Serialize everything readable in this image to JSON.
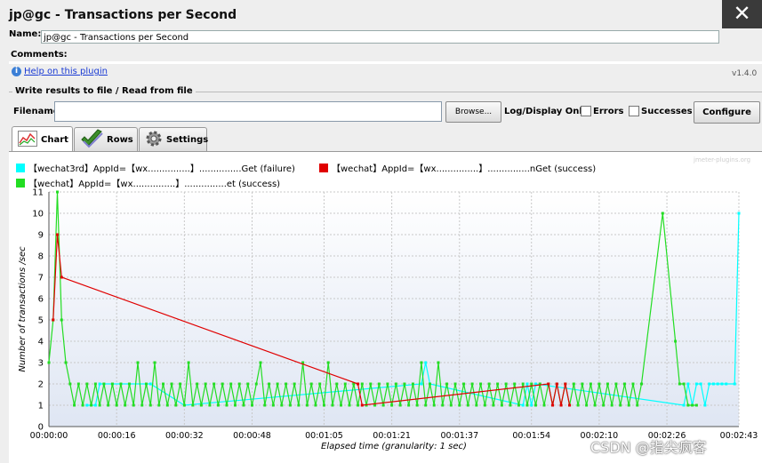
{
  "window": {
    "title": "jp@gc - Transactions per Second",
    "close_glyph": "✕"
  },
  "name_row": {
    "label": "Name:",
    "value": "jp@gc - Transactions per Second"
  },
  "comments": {
    "label": "Comments:"
  },
  "help": {
    "link_text": "Help on this plugin",
    "version": "v1.4.0"
  },
  "file_section": {
    "legend": "Write results to file / Read from file",
    "filename_label": "Filename",
    "filename_value": "",
    "browse_label": "Browse...",
    "log_display_label": "Log/Display Only:",
    "errors_label": "Errors",
    "successes_label": "Successes",
    "configure_label": "Configure"
  },
  "tabs": [
    {
      "label": "Chart",
      "icon": "chart-icon",
      "active": true
    },
    {
      "label": "Rows",
      "icon": "checkmark-icon",
      "active": false
    },
    {
      "label": "Settings",
      "icon": "gear-icon",
      "active": false
    }
  ],
  "watermark": "jmeter-plugins.org",
  "footer_watermark": "CSDN @指尖疯客",
  "colors": {
    "cyan": "#00ffff",
    "red": "#e00000",
    "green": "#22dd22",
    "grid": "#c8c8c8"
  },
  "chart_data": {
    "type": "line",
    "ylabel": "Number of transactions /sec",
    "xlabel": "Elapsed time (granularity: 1 sec)",
    "ylim": [
      0,
      11
    ],
    "yticks": [
      0,
      1,
      2,
      3,
      4,
      5,
      6,
      7,
      8,
      9,
      10,
      11
    ],
    "xlim": [
      0,
      163
    ],
    "xticks": [
      {
        "t": 0,
        "label": "00:00:00"
      },
      {
        "t": 16,
        "label": "00:00:16"
      },
      {
        "t": 32,
        "label": "00:00:32"
      },
      {
        "t": 48,
        "label": "00:00:48"
      },
      {
        "t": 65,
        "label": "00:01:05"
      },
      {
        "t": 81,
        "label": "00:01:21"
      },
      {
        "t": 97,
        "label": "00:01:37"
      },
      {
        "t": 114,
        "label": "00:01:54"
      },
      {
        "t": 130,
        "label": "00:02:10"
      },
      {
        "t": 146,
        "label": "00:02:26"
      },
      {
        "t": 163,
        "label": "00:02:43"
      }
    ],
    "series": [
      {
        "name": "【wechat3rd】AppId=【wx...............】...............Get (failure)",
        "color": "#00ffff",
        "points": [
          [
            9,
            1
          ],
          [
            10,
            1
          ],
          [
            11,
            1
          ],
          [
            12,
            2
          ],
          [
            24,
            2
          ],
          [
            32,
            1
          ],
          [
            88,
            2
          ],
          [
            89,
            3
          ],
          [
            90,
            2
          ],
          [
            112,
            1
          ],
          [
            113,
            2
          ],
          [
            114,
            1
          ],
          [
            115,
            2
          ],
          [
            150,
            1
          ],
          [
            151,
            2
          ],
          [
            152,
            1
          ],
          [
            153,
            2
          ],
          [
            154,
            2
          ],
          [
            155,
            1
          ],
          [
            156,
            2
          ],
          [
            157,
            2
          ],
          [
            158,
            2
          ],
          [
            159,
            2
          ],
          [
            160,
            2
          ],
          [
            162,
            2
          ],
          [
            163,
            10
          ]
        ]
      },
      {
        "name": "【wechat】AppId=【wx...............】...............nGet (success)",
        "color": "#e00000",
        "points": [
          [
            1,
            5
          ],
          [
            2,
            9
          ],
          [
            3,
            7
          ],
          [
            73,
            2
          ],
          [
            74,
            1
          ],
          [
            118,
            2
          ],
          [
            119,
            1
          ],
          [
            120,
            2
          ],
          [
            121,
            1
          ],
          [
            122,
            2
          ],
          [
            123,
            1
          ]
        ]
      },
      {
        "name": "【wechat】AppId=【wx...............】...............et (success)",
        "color": "#22dd22",
        "points": [
          [
            0,
            3
          ],
          [
            1,
            5
          ],
          [
            2,
            11
          ],
          [
            3,
            5
          ],
          [
            4,
            3
          ],
          [
            5,
            2
          ],
          [
            6,
            1
          ],
          [
            7,
            2
          ],
          [
            8,
            1
          ],
          [
            9,
            2
          ],
          [
            10,
            1
          ],
          [
            11,
            2
          ],
          [
            12,
            1
          ],
          [
            13,
            2
          ],
          [
            14,
            1
          ],
          [
            15,
            2
          ],
          [
            16,
            1
          ],
          [
            17,
            2
          ],
          [
            18,
            1
          ],
          [
            19,
            2
          ],
          [
            20,
            1
          ],
          [
            21,
            3
          ],
          [
            22,
            1
          ],
          [
            23,
            2
          ],
          [
            24,
            1
          ],
          [
            25,
            3
          ],
          [
            26,
            1
          ],
          [
            27,
            2
          ],
          [
            28,
            1
          ],
          [
            29,
            2
          ],
          [
            30,
            1
          ],
          [
            31,
            2
          ],
          [
            32,
            1
          ],
          [
            33,
            3
          ],
          [
            34,
            1
          ],
          [
            35,
            2
          ],
          [
            36,
            1
          ],
          [
            37,
            2
          ],
          [
            38,
            1
          ],
          [
            39,
            2
          ],
          [
            40,
            1
          ],
          [
            41,
            2
          ],
          [
            42,
            1
          ],
          [
            43,
            2
          ],
          [
            44,
            1
          ],
          [
            45,
            2
          ],
          [
            46,
            1
          ],
          [
            47,
            2
          ],
          [
            48,
            1
          ],
          [
            49,
            2
          ],
          [
            50,
            3
          ],
          [
            51,
            1
          ],
          [
            52,
            2
          ],
          [
            53,
            1
          ],
          [
            54,
            2
          ],
          [
            55,
            1
          ],
          [
            56,
            2
          ],
          [
            57,
            1
          ],
          [
            58,
            2
          ],
          [
            59,
            1
          ],
          [
            60,
            3
          ],
          [
            61,
            1
          ],
          [
            62,
            2
          ],
          [
            63,
            1
          ],
          [
            64,
            2
          ],
          [
            65,
            1
          ],
          [
            66,
            3
          ],
          [
            67,
            1
          ],
          [
            68,
            2
          ],
          [
            69,
            1
          ],
          [
            70,
            2
          ],
          [
            71,
            1
          ],
          [
            72,
            2
          ],
          [
            73,
            1
          ],
          [
            74,
            2
          ],
          [
            75,
            1
          ],
          [
            76,
            2
          ],
          [
            77,
            1
          ],
          [
            78,
            2
          ],
          [
            79,
            1
          ],
          [
            80,
            2
          ],
          [
            81,
            1
          ],
          [
            82,
            2
          ],
          [
            83,
            1
          ],
          [
            84,
            2
          ],
          [
            85,
            1
          ],
          [
            86,
            2
          ],
          [
            87,
            1
          ],
          [
            88,
            3
          ],
          [
            89,
            1
          ],
          [
            90,
            2
          ],
          [
            91,
            1
          ],
          [
            92,
            3
          ],
          [
            93,
            1
          ],
          [
            94,
            2
          ],
          [
            95,
            1
          ],
          [
            96,
            2
          ],
          [
            97,
            1
          ],
          [
            98,
            2
          ],
          [
            99,
            1
          ],
          [
            100,
            2
          ],
          [
            101,
            1
          ],
          [
            102,
            2
          ],
          [
            103,
            1
          ],
          [
            104,
            2
          ],
          [
            105,
            1
          ],
          [
            106,
            2
          ],
          [
            107,
            1
          ],
          [
            108,
            2
          ],
          [
            109,
            1
          ],
          [
            110,
            2
          ],
          [
            111,
            1
          ],
          [
            112,
            2
          ],
          [
            113,
            1
          ],
          [
            114,
            2
          ],
          [
            115,
            1
          ],
          [
            116,
            2
          ],
          [
            117,
            1
          ],
          [
            118,
            2
          ],
          [
            119,
            1
          ],
          [
            120,
            2
          ],
          [
            121,
            1
          ],
          [
            122,
            2
          ],
          [
            123,
            1
          ],
          [
            124,
            2
          ],
          [
            125,
            1
          ],
          [
            126,
            2
          ],
          [
            127,
            1
          ],
          [
            128,
            2
          ],
          [
            129,
            1
          ],
          [
            130,
            2
          ],
          [
            131,
            1
          ],
          [
            132,
            2
          ],
          [
            133,
            1
          ],
          [
            134,
            2
          ],
          [
            135,
            1
          ],
          [
            136,
            2
          ],
          [
            137,
            1
          ],
          [
            138,
            2
          ],
          [
            139,
            1
          ],
          [
            140,
            2
          ],
          [
            145,
            10
          ],
          [
            148,
            4
          ],
          [
            149,
            2
          ],
          [
            150,
            2
          ],
          [
            151,
            1
          ],
          [
            152,
            1
          ],
          [
            153,
            1
          ]
        ]
      }
    ]
  }
}
